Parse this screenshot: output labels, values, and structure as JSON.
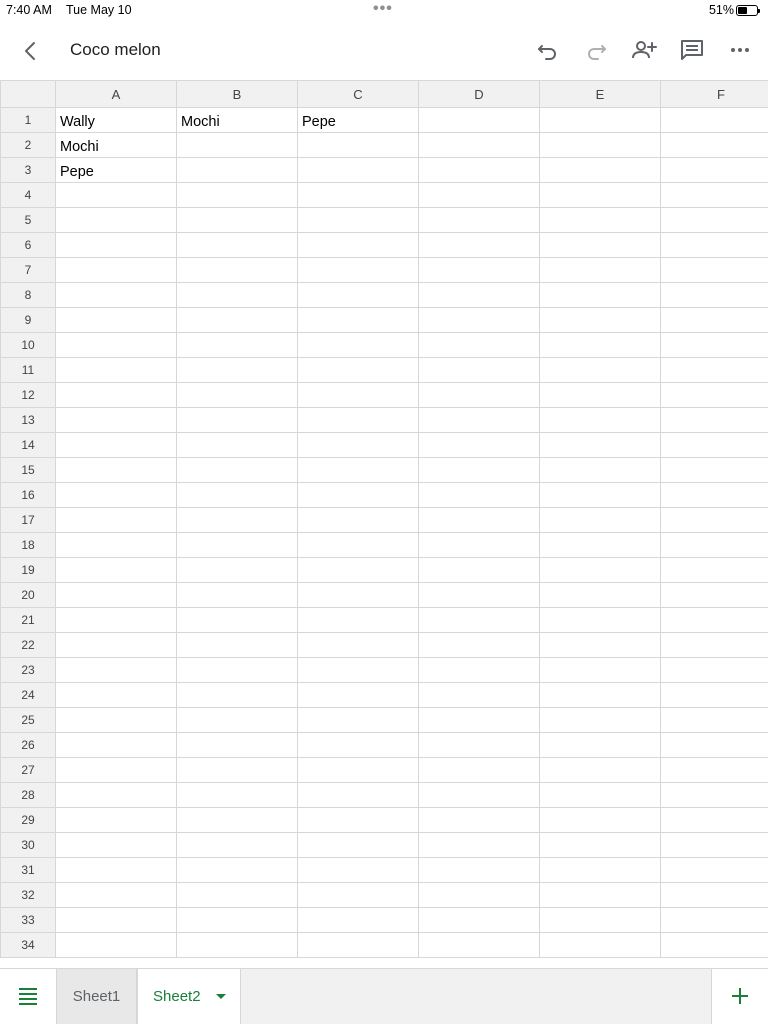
{
  "status": {
    "time": "7:40 AM",
    "date": "Tue May 10",
    "battery_percent": "51%",
    "battery_level": 0.51
  },
  "toolbar": {
    "title": "Coco melon",
    "icons": [
      "back-icon",
      "undo-icon",
      "redo-icon",
      "share-icon",
      "comment-icon",
      "more-icon"
    ]
  },
  "grid": {
    "columns": [
      "A",
      "B",
      "C",
      "D",
      "E",
      "F"
    ],
    "rows": [
      {
        "num": "1",
        "cells": [
          "Wally",
          "Mochi",
          "Pepe",
          "",
          "",
          ""
        ]
      },
      {
        "num": "2",
        "cells": [
          "Mochi",
          "",
          "",
          "",
          "",
          ""
        ]
      },
      {
        "num": "3",
        "cells": [
          "Pepe",
          "",
          "",
          "",
          "",
          ""
        ]
      },
      {
        "num": "4",
        "cells": [
          "",
          "",
          "",
          "",
          "",
          ""
        ]
      },
      {
        "num": "5",
        "cells": [
          "",
          "",
          "",
          "",
          "",
          ""
        ]
      },
      {
        "num": "6",
        "cells": [
          "",
          "",
          "",
          "",
          "",
          ""
        ]
      },
      {
        "num": "7",
        "cells": [
          "",
          "",
          "",
          "",
          "",
          ""
        ]
      },
      {
        "num": "8",
        "cells": [
          "",
          "",
          "",
          "",
          "",
          ""
        ]
      },
      {
        "num": "9",
        "cells": [
          "",
          "",
          "",
          "",
          "",
          ""
        ]
      },
      {
        "num": "10",
        "cells": [
          "",
          "",
          "",
          "",
          "",
          ""
        ]
      },
      {
        "num": "11",
        "cells": [
          "",
          "",
          "",
          "",
          "",
          ""
        ]
      },
      {
        "num": "12",
        "cells": [
          "",
          "",
          "",
          "",
          "",
          ""
        ]
      },
      {
        "num": "13",
        "cells": [
          "",
          "",
          "",
          "",
          "",
          ""
        ]
      },
      {
        "num": "14",
        "cells": [
          "",
          "",
          "",
          "",
          "",
          ""
        ]
      },
      {
        "num": "15",
        "cells": [
          "",
          "",
          "",
          "",
          "",
          ""
        ]
      },
      {
        "num": "16",
        "cells": [
          "",
          "",
          "",
          "",
          "",
          ""
        ]
      },
      {
        "num": "17",
        "cells": [
          "",
          "",
          "",
          "",
          "",
          ""
        ]
      },
      {
        "num": "18",
        "cells": [
          "",
          "",
          "",
          "",
          "",
          ""
        ]
      },
      {
        "num": "19",
        "cells": [
          "",
          "",
          "",
          "",
          "",
          ""
        ]
      },
      {
        "num": "20",
        "cells": [
          "",
          "",
          "",
          "",
          "",
          ""
        ]
      },
      {
        "num": "21",
        "cells": [
          "",
          "",
          "",
          "",
          "",
          ""
        ]
      },
      {
        "num": "22",
        "cells": [
          "",
          "",
          "",
          "",
          "",
          ""
        ]
      },
      {
        "num": "23",
        "cells": [
          "",
          "",
          "",
          "",
          "",
          ""
        ]
      },
      {
        "num": "24",
        "cells": [
          "",
          "",
          "",
          "",
          "",
          ""
        ]
      },
      {
        "num": "25",
        "cells": [
          "",
          "",
          "",
          "",
          "",
          ""
        ]
      },
      {
        "num": "26",
        "cells": [
          "",
          "",
          "",
          "",
          "",
          ""
        ]
      },
      {
        "num": "27",
        "cells": [
          "",
          "",
          "",
          "",
          "",
          ""
        ]
      },
      {
        "num": "28",
        "cells": [
          "",
          "",
          "",
          "",
          "",
          ""
        ]
      },
      {
        "num": "29",
        "cells": [
          "",
          "",
          "",
          "",
          "",
          ""
        ]
      },
      {
        "num": "30",
        "cells": [
          "",
          "",
          "",
          "",
          "",
          ""
        ]
      },
      {
        "num": "31",
        "cells": [
          "",
          "",
          "",
          "",
          "",
          ""
        ]
      },
      {
        "num": "32",
        "cells": [
          "",
          "",
          "",
          "",
          "",
          ""
        ]
      },
      {
        "num": "33",
        "cells": [
          "",
          "",
          "",
          "",
          "",
          ""
        ]
      },
      {
        "num": "34",
        "cells": [
          "",
          "",
          "",
          "",
          "",
          ""
        ]
      }
    ]
  },
  "tabs": {
    "menu_icon": "sheets-list-icon",
    "items": [
      {
        "label": "Sheet1",
        "active": false
      },
      {
        "label": "Sheet2",
        "active": true
      }
    ],
    "add_icon": "add-sheet-icon"
  },
  "colors": {
    "accent_green": "#188038",
    "header_gray": "#f1f1f1",
    "gridline": "#d7d7d7"
  }
}
